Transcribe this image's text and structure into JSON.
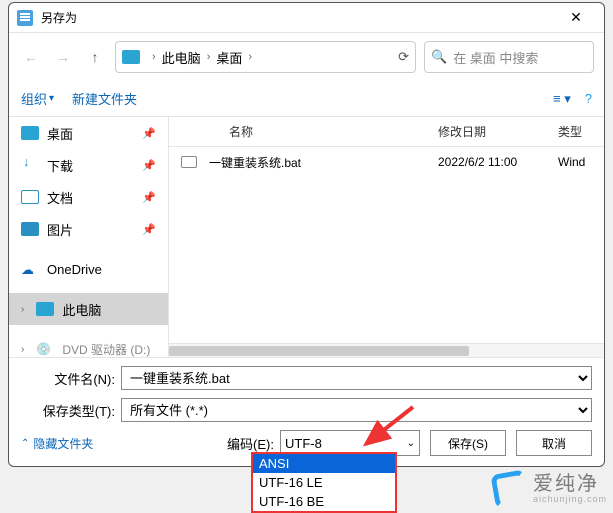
{
  "window": {
    "title": "另存为"
  },
  "nav": {
    "breadcrumb": {
      "root": "此电脑",
      "folder": "桌面"
    },
    "search_placeholder": "在 桌面 中搜索"
  },
  "toolbar": {
    "organize": "组织",
    "new_folder": "新建文件夹"
  },
  "sidebar": {
    "items": [
      {
        "label": "桌面",
        "pinned": true
      },
      {
        "label": "下载",
        "pinned": true
      },
      {
        "label": "文档",
        "pinned": true
      },
      {
        "label": "图片",
        "pinned": true
      },
      {
        "label": "OneDrive"
      },
      {
        "label": "此电脑",
        "selected": true
      },
      {
        "label": "DVD 驱动器 (D:)"
      }
    ]
  },
  "filelist": {
    "headers": {
      "name": "名称",
      "date": "修改日期",
      "type": "类型"
    },
    "rows": [
      {
        "name": "一键重装系统.bat",
        "date": "2022/6/2 11:00",
        "type": "Wind"
      }
    ]
  },
  "fields": {
    "filename_label": "文件名(N):",
    "filename_value": "一键重装系统.bat",
    "filetype_label": "保存类型(T):",
    "filetype_value": "所有文件 (*.*)"
  },
  "footer": {
    "hide_link": "隐藏文件夹",
    "encoding_label": "编码(E):",
    "encoding_value": "UTF-8",
    "encoding_options": [
      "ANSI",
      "UTF-16 LE",
      "UTF-16 BE"
    ],
    "save": "保存(S)",
    "cancel": "取消"
  },
  "watermark": {
    "brand": "爱纯净",
    "url": "aichunjing.com"
  }
}
